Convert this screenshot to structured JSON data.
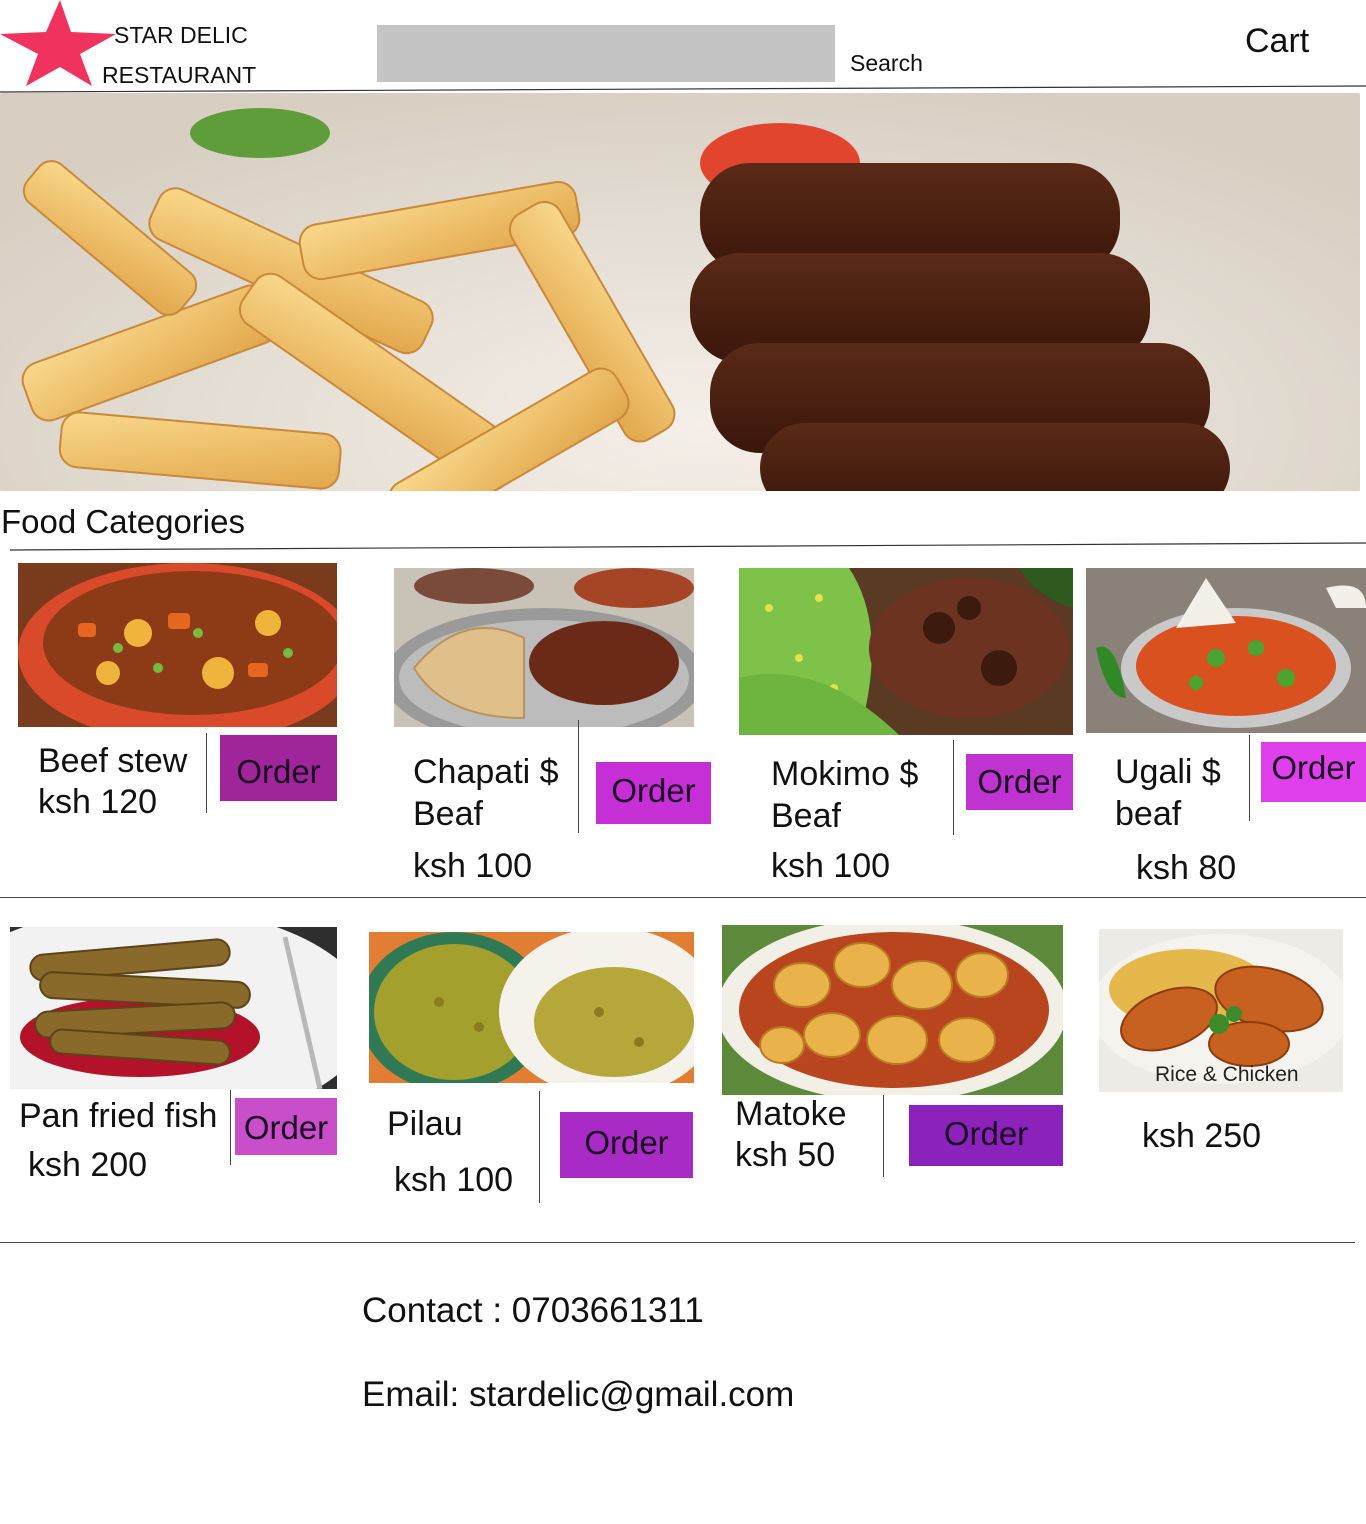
{
  "header": {
    "brand_line1": "STAR DELIC",
    "brand_line2": "RESTAURANT",
    "search_placeholder": "",
    "search_label": "Search",
    "cart_label": "Cart",
    "logo_color": "#f0325e"
  },
  "section_title": "Food Categories",
  "items": [
    {
      "name_line1": "Beef stew",
      "name_line2": "",
      "price": "ksh 120",
      "order_label": "Order",
      "order_color": "#a0249a"
    },
    {
      "name_line1": "Chapati $",
      "name_line2": "Beaf",
      "price": "ksh 100",
      "order_label": "Order",
      "order_color": "#c62fd6"
    },
    {
      "name_line1": "Mokimo $",
      "name_line2": "Beaf",
      "price": "ksh 100",
      "order_label": "Order",
      "order_color": "#bf34d1"
    },
    {
      "name_line1": "Ugali  $",
      "name_line2": "beaf",
      "price": "ksh 80",
      "order_label": "Order",
      "order_color": "#e040ec"
    },
    {
      "name_line1": "Pan fried fish",
      "name_line2": "",
      "price": "ksh 200",
      "order_label": "Order",
      "order_color": "#c94ec9"
    },
    {
      "name_line1": "Pilau",
      "name_line2": "",
      "price": "ksh 100",
      "order_label": "Order",
      "order_color": "#a92bc5"
    },
    {
      "name_line1": "Matoke",
      "name_line2": "",
      "price": "ksh 50",
      "order_label": "Order",
      "order_color": "#8a22bb"
    },
    {
      "name_line1": "",
      "name_line2": "",
      "price": "ksh 250",
      "image_caption": "Rice & Chicken"
    }
  ],
  "footer": {
    "contact": "Contact  :  0703661311",
    "email": "Email: stardelic@gmail.com"
  }
}
